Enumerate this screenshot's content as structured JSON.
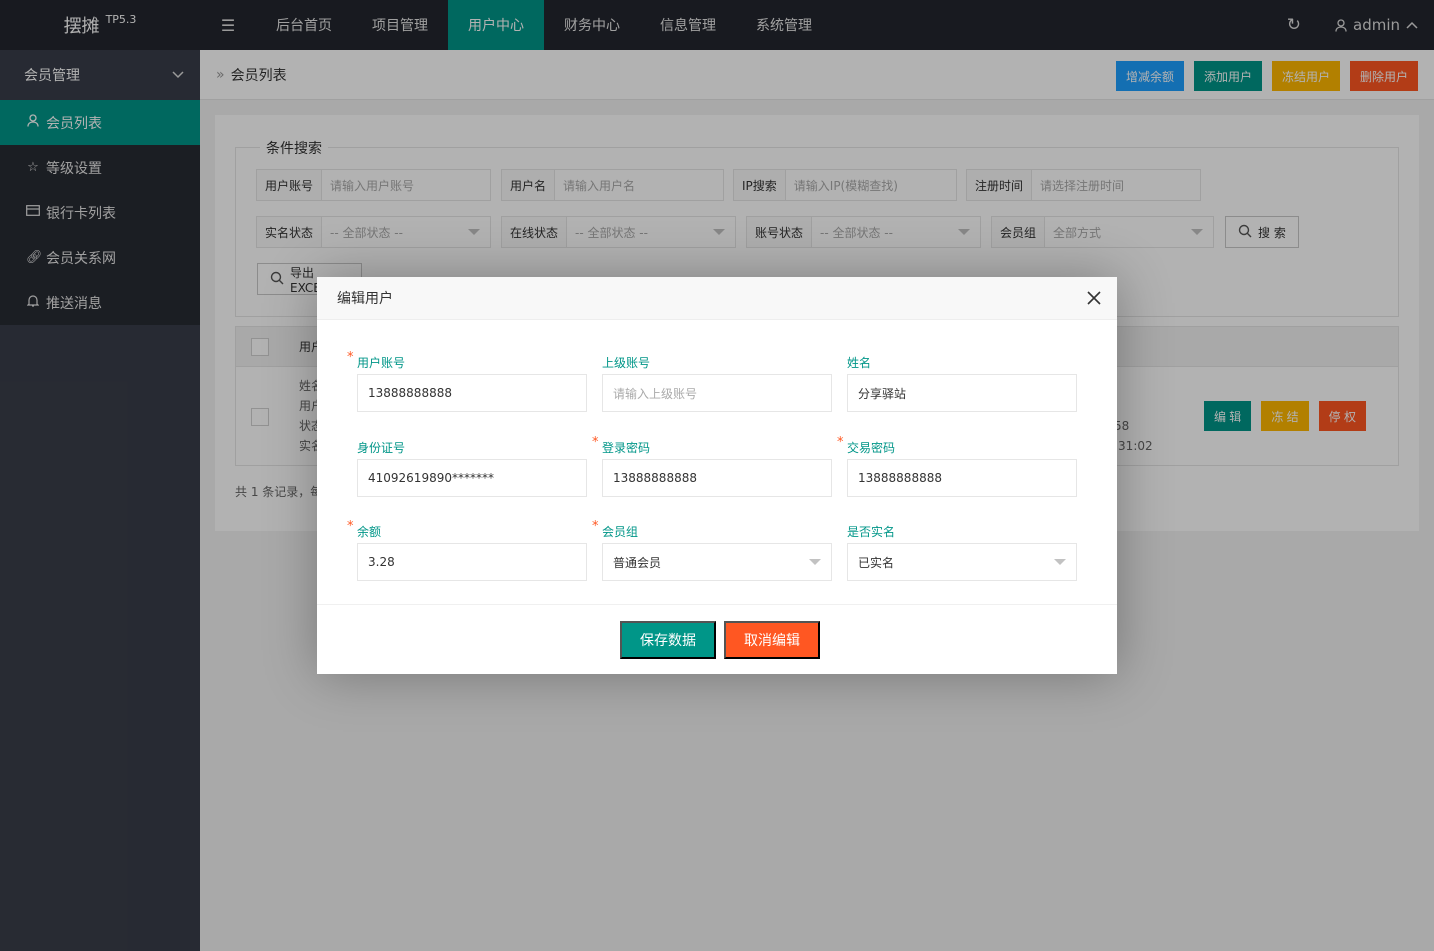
{
  "app": {
    "logo": "摆摊",
    "version": "TP5.3"
  },
  "nav": {
    "items": [
      {
        "label": "后台首页"
      },
      {
        "label": "项目管理"
      },
      {
        "label": "用户中心"
      },
      {
        "label": "财务中心"
      },
      {
        "label": "信息管理"
      },
      {
        "label": "系统管理"
      }
    ],
    "active": "用户中心",
    "user": "admin"
  },
  "sidebar": {
    "group": "会员管理",
    "items": [
      {
        "label": "会员列表",
        "icon": "user-icon"
      },
      {
        "label": "等级设置",
        "icon": "star-icon"
      },
      {
        "label": "银行卡列表",
        "icon": "card-icon"
      },
      {
        "label": "会员关系网",
        "icon": "link-icon"
      },
      {
        "label": "推送消息",
        "icon": "bell-icon"
      }
    ]
  },
  "page": {
    "breadcrumb": "会员列表",
    "actions": {
      "add_balance": "增减余额",
      "add_user": "添加用户",
      "freeze_user": "冻结用户",
      "delete_user": "删除用户"
    }
  },
  "search": {
    "legend": "条件搜索",
    "account_label": "用户账号",
    "account_ph": "请输入用户账号",
    "name_label": "用户名",
    "name_ph": "请输入用户名",
    "ip_label": "IP搜索",
    "ip_ph": "请输入IP(模糊查找)",
    "reg_label": "注册时间",
    "reg_ph": "请选择注册时间",
    "realname_label": "实名状态",
    "realname_val": "-- 全部状态 --",
    "online_label": "在线状态",
    "online_val": "-- 全部状态 --",
    "acct_status_label": "账号状态",
    "acct_status_val": "-- 全部状态 --",
    "group_label": "会员组",
    "group_val": "全部方式",
    "search_btn": "搜 索",
    "export_btn": "导出EXCEL"
  },
  "table": {
    "header_col": "用户",
    "row_lines": [
      "姓名",
      "用户",
      "状态",
      "实名"
    ],
    "right_lines": [
      "58",
      ":31:02"
    ],
    "btn_edit": "编 辑",
    "btn_freeze": "冻 结",
    "btn_disable": "停 权",
    "footer": "共 1 条记录，每"
  },
  "modal": {
    "title": "编辑用户",
    "fields": {
      "account": {
        "label": "用户账号",
        "value": "13888888888"
      },
      "parent": {
        "label": "上级账号",
        "placeholder": "请输入上级账号"
      },
      "name": {
        "label": "姓名",
        "value": "分享驿站"
      },
      "idcard": {
        "label": "身份证号",
        "value": "41092619890*******"
      },
      "login_pwd": {
        "label": "登录密码",
        "value": "13888888888"
      },
      "trade_pwd": {
        "label": "交易密码",
        "value": "13888888888"
      },
      "balance": {
        "label": "余额",
        "value": "3.28"
      },
      "group": {
        "label": "会员组",
        "value": "普通会员"
      },
      "realname": {
        "label": "是否实名",
        "value": "已实名"
      }
    },
    "save": "保存数据",
    "cancel": "取消编辑"
  },
  "colors": {
    "primary": "#009688",
    "blue": "#1e9fff",
    "yellow": "#ffb800",
    "red": "#ff5722",
    "topbar": "#23262e",
    "sidebar": "#393d49"
  }
}
